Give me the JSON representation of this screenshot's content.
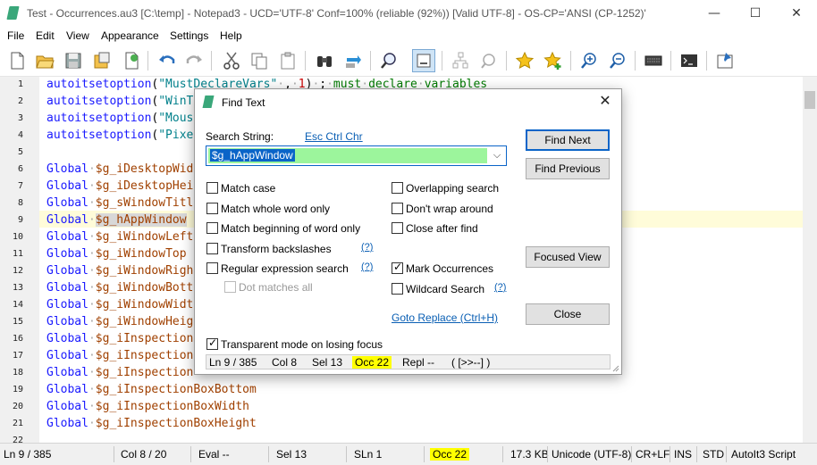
{
  "window": {
    "title": "Test - Occurrences.au3 [C:\\temp] - Notepad3 - UCD='UTF-8' Conf=100% (reliable (92%)) [Valid UTF-8] - OS-CP='ANSI (CP-1252)'",
    "minimize": "—",
    "maximize": "☐",
    "close": "✕"
  },
  "menu": [
    "File",
    "Edit",
    "View",
    "Appearance",
    "Settings",
    "Help"
  ],
  "toolbar_icons": [
    "new-icon",
    "open-icon",
    "save-icon",
    "save-as-icon",
    "browse-icon",
    "undo-icon",
    "redo-icon",
    "cut-icon",
    "copy-icon",
    "paste-icon",
    "find-icon",
    "replace-icon",
    "find-in-files-icon",
    "focused-view-icon",
    "tree-icon",
    "mark-icon",
    "favorites-icon",
    "add-favorite-icon",
    "zoom-in-icon",
    "zoom-out-icon",
    "keyboard-icon",
    "terminal-icon",
    "pin-icon"
  ],
  "line_numbers": [
    "1",
    "2",
    "3",
    "4",
    "5",
    "6",
    "7",
    "8",
    "9",
    "10",
    "11",
    "12",
    "13",
    "14",
    "15",
    "16",
    "17",
    "18",
    "19",
    "20",
    "21",
    "22"
  ],
  "code_lines": [
    "autoitsetoption(\"MustDeclareVars\", 1) ; must declare variables",
    "autoitsetoption(\"WinT",
    "autoitsetoption(\"Mous",
    "autoitsetoption(\"Pixe",
    "",
    "Global $g_iDesktopWid",
    "Global $g_iDesktopHei",
    "Global $g_sWindowTitl",
    "Global $g_hAppWindow",
    "Global $g_iWindowLeft",
    "Global $g_iWindowTop",
    "Global $g_iWindowRigh",
    "Global $g_iWindowBott",
    "Global $g_iWindowWidt",
    "Global $g_iWindowHeig",
    "Global $g_iInspection",
    "Global $g_iInspection",
    "Global $g_iInspection",
    "Global $g_iInspectionBoxBottom",
    "Global $g_iInspectionBoxWidth",
    "Global $g_iInspectionBoxHeight",
    ""
  ],
  "status": {
    "ln": "Ln  9 / 385",
    "col": "Col  8 / 20",
    "eval": "Eval  --",
    "sel": "Sel  13",
    "sln": "SLn  1",
    "occ": "Occ  22",
    "size": "17.3 KB",
    "encoding": "Unicode (UTF-8)",
    "eol": "CR+LF",
    "ins": "INS",
    "std": "STD",
    "lexer": "AutoIt3 Script"
  },
  "dialog": {
    "title": "Find Text",
    "close": "✕",
    "search_label": "Search String:",
    "esc_link": "Esc Ctrl Chr",
    "search_value": "$g_hAppWindow",
    "options_left": [
      {
        "label": "Match case",
        "checked": false
      },
      {
        "label": "Match whole word only",
        "checked": false
      },
      {
        "label": "Match beginning of word only",
        "checked": false
      },
      {
        "label": "Transform backslashes",
        "checked": false
      },
      {
        "label": "Regular expression search",
        "checked": false
      },
      {
        "label": "Dot matches all",
        "checked": false,
        "disabled": true
      }
    ],
    "options_right": [
      {
        "label": "Overlapping search",
        "checked": false
      },
      {
        "label": "Don't wrap around",
        "checked": false
      },
      {
        "label": "Close after find",
        "checked": false
      },
      {
        "label": "Mark Occurrences",
        "checked": true
      },
      {
        "label": "Wildcard Search",
        "checked": false
      }
    ],
    "help_mark": "(?)",
    "goto_replace": "Goto Replace (Ctrl+H)",
    "transparent_label": "Transparent mode on losing focus",
    "transparent_checked": true,
    "buttons": {
      "find_next": "Find Next",
      "find_previous": "Find Previous",
      "focused_view": "Focused View",
      "close": "Close"
    },
    "status": {
      "ln": "Ln  9 / 385",
      "col": "Col  8",
      "sel": "Sel  13",
      "occ": "Occ  22",
      "repl": "Repl  --",
      "nav": "( [>>--] )"
    }
  },
  "colors": {
    "current_line": "#fffcd9",
    "occ_highlight": "#ffff00",
    "search_field": "#9cf59c",
    "accent": "#0a64c8"
  }
}
